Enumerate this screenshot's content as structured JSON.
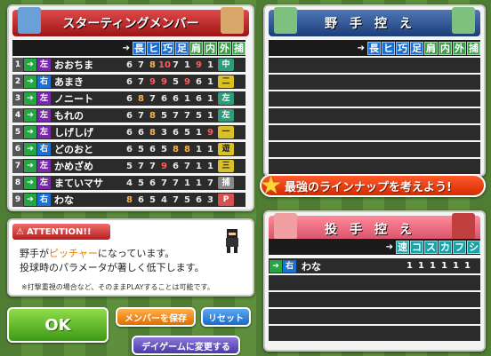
{
  "starting": {
    "title": "スターティングメンバー",
    "columns": [
      "長",
      "ヒ",
      "巧",
      "足",
      "肩",
      "内",
      "外",
      "捕"
    ],
    "rows": [
      {
        "num": "1",
        "hand": "左",
        "name": "おおちま",
        "stats": [
          "6",
          "7",
          "8",
          "10",
          "7",
          "1",
          "9",
          "1"
        ],
        "pos": "中"
      },
      {
        "num": "2",
        "hand": "右",
        "name": "あまき",
        "stats": [
          "6",
          "7",
          "9",
          "9",
          "5",
          "9",
          "6",
          "1"
        ],
        "pos": "二"
      },
      {
        "num": "3",
        "hand": "左",
        "name": "ノニート",
        "stats": [
          "6",
          "8",
          "7",
          "6",
          "6",
          "1",
          "6",
          "1"
        ],
        "pos": "左"
      },
      {
        "num": "4",
        "hand": "左",
        "name": "もれの",
        "stats": [
          "6",
          "7",
          "8",
          "5",
          "7",
          "7",
          "5",
          "1"
        ],
        "pos": "左"
      },
      {
        "num": "5",
        "hand": "左",
        "name": "しげしげ",
        "stats": [
          "6",
          "6",
          "8",
          "3",
          "6",
          "5",
          "1",
          "9"
        ],
        "pos": "一"
      },
      {
        "num": "6",
        "hand": "右",
        "name": "どのおと",
        "stats": [
          "6",
          "5",
          "6",
          "5",
          "8",
          "8",
          "1",
          "1"
        ],
        "pos": "遊"
      },
      {
        "num": "7",
        "hand": "左",
        "name": "かめざめ",
        "stats": [
          "5",
          "7",
          "7",
          "9",
          "6",
          "7",
          "1",
          "1"
        ],
        "pos": "三"
      },
      {
        "num": "8",
        "hand": "左",
        "name": "まていマサ",
        "stats": [
          "4",
          "5",
          "6",
          "7",
          "7",
          "1",
          "1",
          "7"
        ],
        "pos": "捕"
      },
      {
        "num": "9",
        "hand": "右",
        "name": "わな",
        "stats": [
          "8",
          "6",
          "5",
          "4",
          "7",
          "5",
          "6",
          "3"
        ],
        "pos": "P"
      }
    ]
  },
  "bench": {
    "title": "野手控え",
    "columns": [
      "長",
      "ヒ",
      "巧",
      "足",
      "肩",
      "内",
      "外",
      "捕"
    ]
  },
  "callout": "最強のラインナップを考えよう!",
  "pitchers": {
    "title": "投手控え",
    "columns": [
      "速",
      "コ",
      "ス",
      "カ",
      "フ",
      "シ"
    ],
    "rows": [
      {
        "hand": "右",
        "name": "わな",
        "stats": [
          "1",
          "1",
          "1",
          "1",
          "1",
          "1"
        ]
      }
    ]
  },
  "attention": {
    "label": "ATTENTION!!",
    "line1_pre": "野手が",
    "line1_hl": "ピッチャー",
    "line1_post": "になっています。",
    "line2": "投球時のパラメータが著しく低下します。",
    "note": "※打撃重視の場合など、そのままPLAYすることは可能です。"
  },
  "buttons": {
    "ok": "OK",
    "save": "メンバーを保存",
    "reset": "リセット",
    "day": "デイゲームに変更する"
  },
  "colors": {
    "red_header": "#c42a2a",
    "blue_header": "#2a4f91",
    "ok_green": "#5cb82a"
  }
}
